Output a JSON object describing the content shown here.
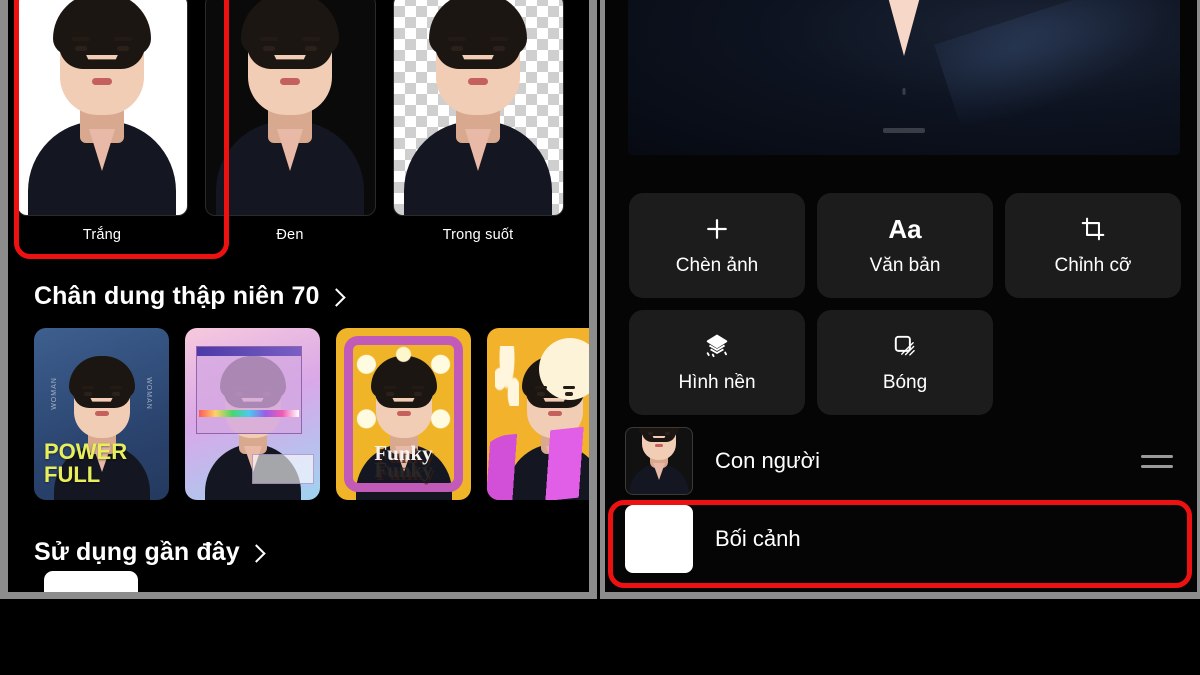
{
  "app": {
    "background_color": "#000000",
    "panel_border_color": "#8c8c8c",
    "highlight_color": "#ee1111"
  },
  "left_panel": {
    "background_options": {
      "items": [
        {
          "label": "Trắng",
          "swatch": "white",
          "selected": true
        },
        {
          "label": "Đen",
          "swatch": "black",
          "selected": false
        },
        {
          "label": "Trong suốt",
          "swatch": "transparent",
          "selected": false
        }
      ]
    },
    "sections": [
      {
        "title": "Chân dung thập niên 70",
        "chevron": "chevron-right-icon",
        "templates": [
          {
            "caption_line1": "POWER",
            "caption_line2": "FULL",
            "side_word": "WOMAN",
            "style": "navy-denim"
          },
          {
            "caption_line1": "",
            "caption_line2": "",
            "style": "pastel-retro-window"
          },
          {
            "caption_line1": "Funky",
            "caption_line2": "Funky",
            "style": "yellow-funky-frame"
          },
          {
            "caption_line1": "",
            "caption_line2": "",
            "style": "yellow-wave"
          }
        ]
      },
      {
        "title": "Sử dụng gần đây",
        "chevron": "chevron-right-icon",
        "templates": []
      }
    ]
  },
  "right_panel": {
    "preview": {
      "alt": "portrait-preview"
    },
    "tools": [
      {
        "label": "Chèn ảnh",
        "icon": "plus-icon"
      },
      {
        "label": "Văn bản",
        "icon": "text-aa-icon",
        "glyph": "Aa"
      },
      {
        "label": "Chỉnh cỡ",
        "icon": "crop-icon"
      },
      {
        "label": "Hình nền",
        "icon": "layers-sparkle-icon"
      },
      {
        "label": "Bóng",
        "icon": "shadow-square-icon"
      }
    ],
    "layers": [
      {
        "name": "Con người",
        "thumb": "person-thumb",
        "has_drag_handle": true,
        "highlighted": false
      },
      {
        "name": "Bối cảnh",
        "thumb": "blank-white-thumb",
        "has_drag_handle": false,
        "highlighted": true
      }
    ]
  }
}
